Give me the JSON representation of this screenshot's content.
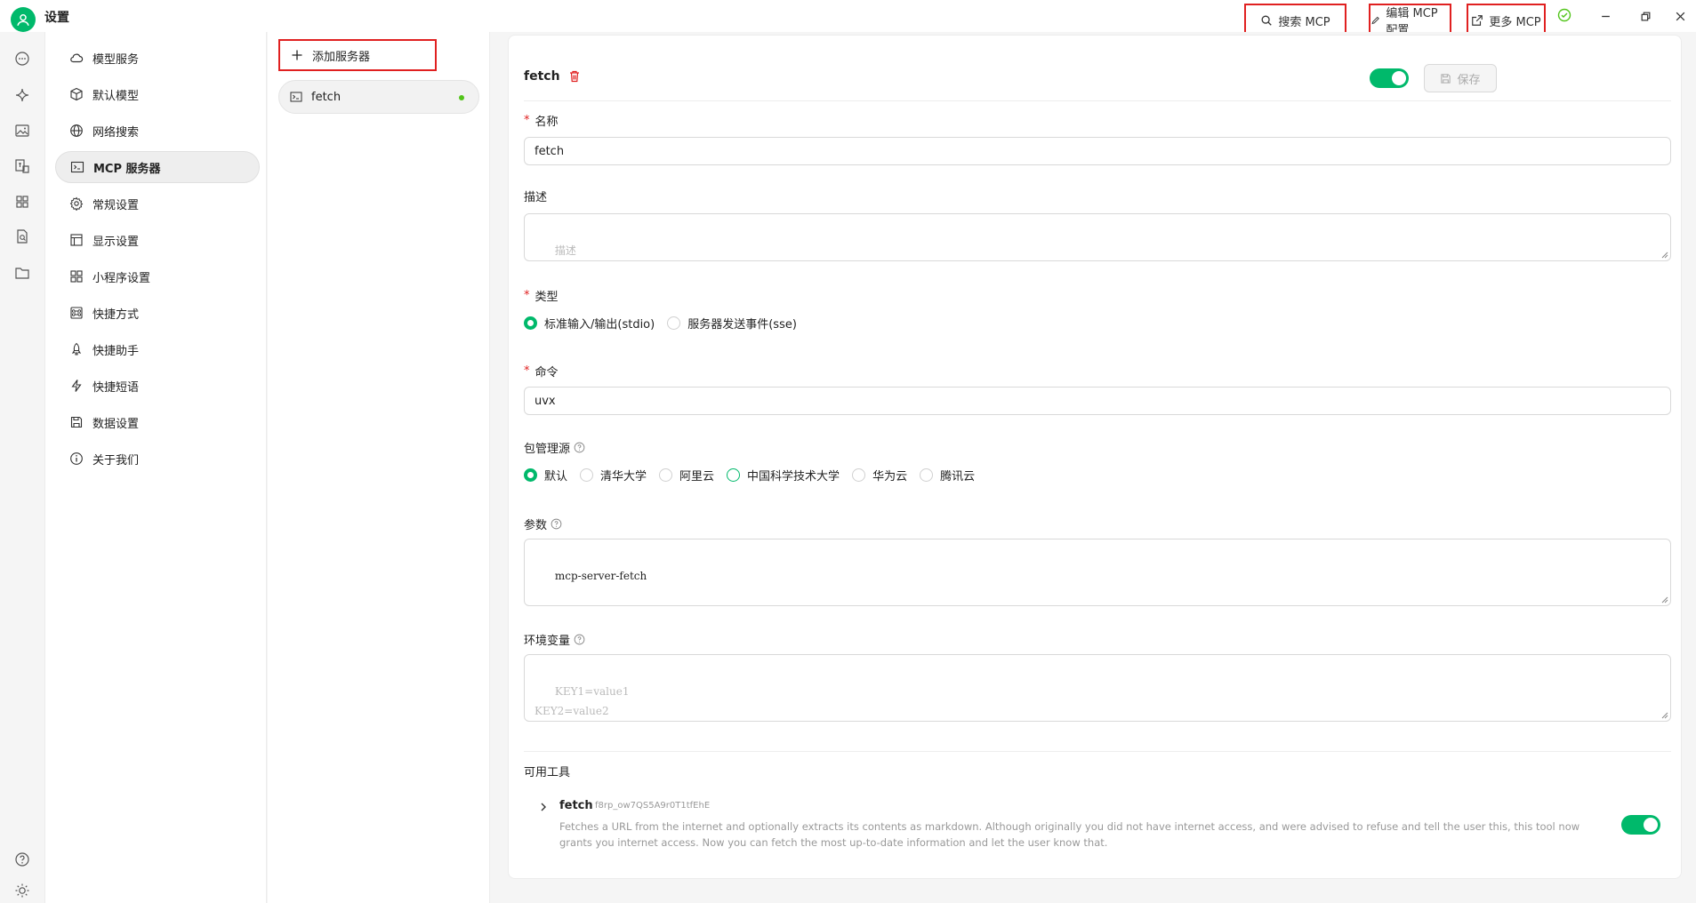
{
  "app": {
    "title": "设置"
  },
  "toolbar": {
    "search_mcp": "搜索 MCP",
    "edit_mcp_config": "编辑 MCP 配置",
    "more_mcp": "更多 MCP"
  },
  "settings_nav": [
    {
      "label": "模型服务",
      "icon": "cloud-icon"
    },
    {
      "label": "默认模型",
      "icon": "cube-icon"
    },
    {
      "label": "网络搜索",
      "icon": "globe-icon"
    },
    {
      "label": "MCP 服务器",
      "icon": "terminal-icon",
      "active": true
    },
    {
      "label": "常规设置",
      "icon": "gear-icon"
    },
    {
      "label": "显示设置",
      "icon": "layout-icon"
    },
    {
      "label": "小程序设置",
      "icon": "grid-icon"
    },
    {
      "label": "快捷方式",
      "icon": "command-icon"
    },
    {
      "label": "快捷助手",
      "icon": "rocket-icon"
    },
    {
      "label": "快捷短语",
      "icon": "zap-icon"
    },
    {
      "label": "数据设置",
      "icon": "save-icon"
    },
    {
      "label": "关于我们",
      "icon": "info-icon"
    }
  ],
  "server_list": {
    "add_label": "添加服务器",
    "servers": [
      {
        "name": "fetch",
        "status": "active"
      }
    ]
  },
  "form": {
    "server_name": "fetch",
    "enabled": true,
    "save_label": "保存",
    "name_label": "名称",
    "name_value": "fetch",
    "desc_label": "描述",
    "desc_placeholder": "描述",
    "type_label": "类型",
    "type_options": [
      "标准输入/输出(stdio)",
      "服务器发送事件(sse)"
    ],
    "type_selected": 0,
    "command_label": "命令",
    "command_value": "uvx",
    "registry_label": "包管理源",
    "registry_options": [
      "默认",
      "清华大学",
      "阿里云",
      "中国科学技术大学",
      "华为云",
      "腾讯云"
    ],
    "registry_selected": 0,
    "args_label": "参数",
    "args_value": "mcp-server-fetch",
    "env_label": "环境变量",
    "env_placeholder": "KEY1=value1\nKEY2=value2",
    "tools_label": "可用工具",
    "tools": [
      {
        "name": "fetch",
        "id": "f8rp_ow7QS5A9r0T1tfEhE",
        "description": "Fetches a URL from the internet and optionally extracts its contents as markdown. Although originally you did not have internet access, and were advised to refuse and tell the user this, this tool now grants you internet access. Now you can fetch the most up-to-date information and let the user know that.",
        "enabled": true
      }
    ]
  },
  "colors": {
    "accent": "#00b96b",
    "danger": "#e02020"
  }
}
